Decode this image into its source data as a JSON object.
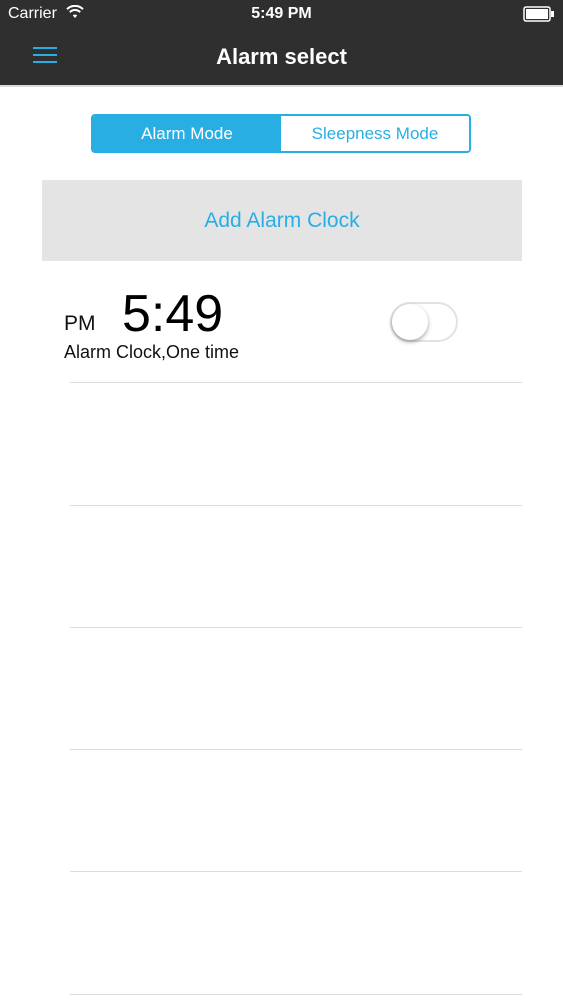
{
  "status_bar": {
    "carrier": "Carrier",
    "time": "5:49 PM",
    "wifi_icon": "wifi-icon",
    "battery_icon": "battery-icon"
  },
  "nav": {
    "title": "Alarm select",
    "menu_icon": "hamburger-menu-icon"
  },
  "segmented": {
    "options": [
      "Alarm Mode",
      "Sleepness Mode"
    ],
    "selected": "Alarm Mode"
  },
  "add_button_label": "Add Alarm Clock",
  "alarms": [
    {
      "ampm": "PM",
      "time": "5:49",
      "description": "Alarm Clock,One time",
      "enabled": false
    }
  ],
  "colors": {
    "accent": "#29aee3",
    "nav_background": "#2f2f2f",
    "add_button_background": "#e4e4e4"
  }
}
